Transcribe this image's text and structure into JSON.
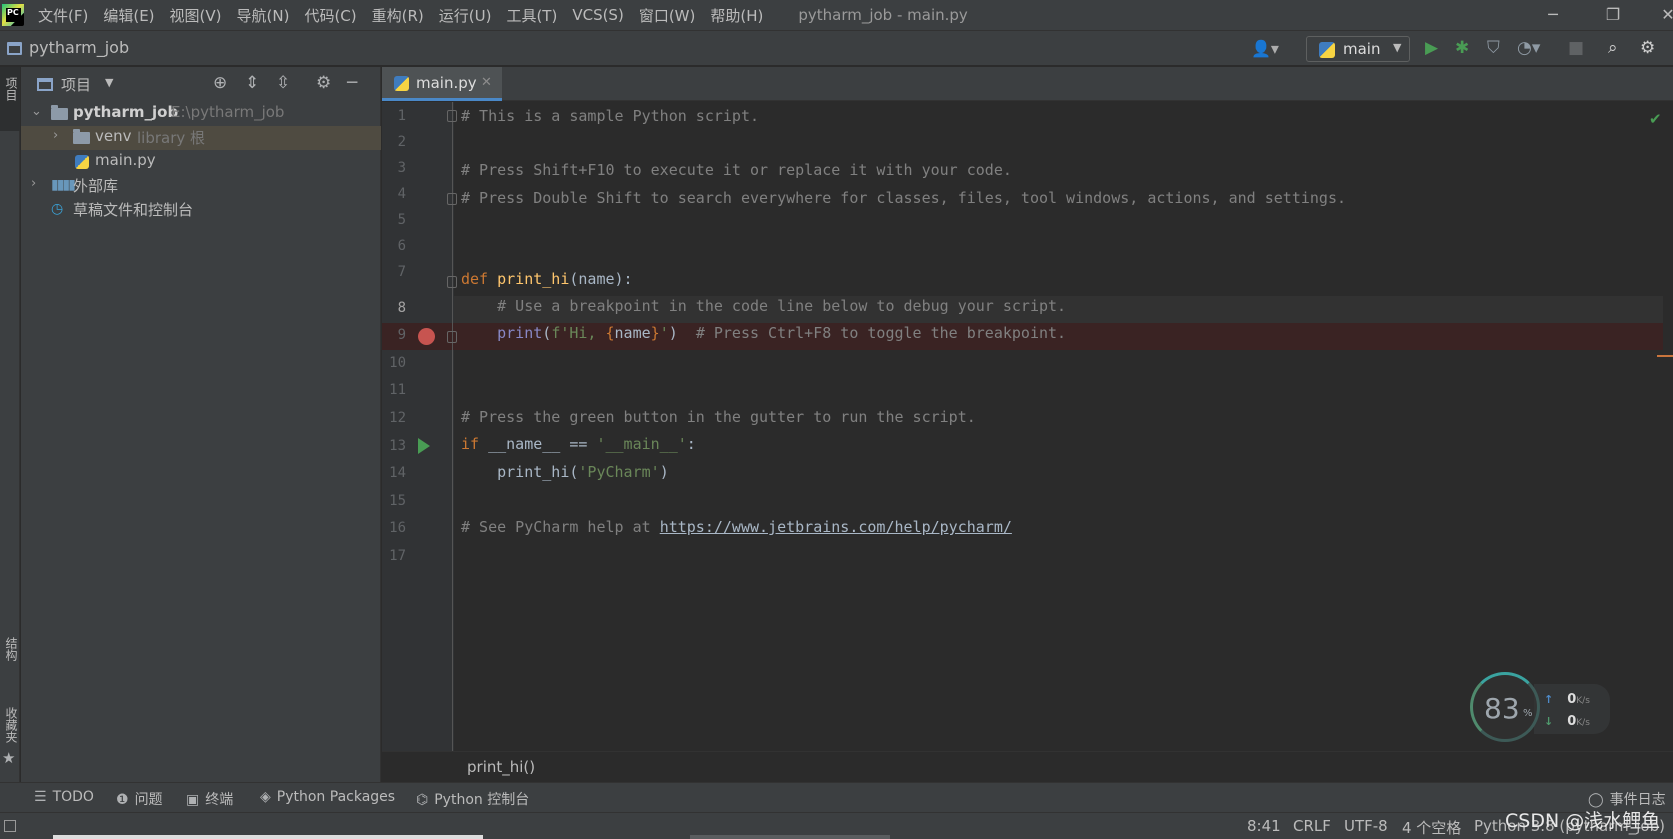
{
  "menubar": {
    "items": [
      "文件(F)",
      "编辑(E)",
      "视图(V)",
      "导航(N)",
      "代码(C)",
      "重构(R)",
      "运行(U)",
      "工具(T)",
      "VCS(S)",
      "窗口(W)",
      "帮助(H)"
    ],
    "window_title": "pytharm_job - main.py"
  },
  "navbar": {
    "project_name": "pytharm_job",
    "run_config": "main"
  },
  "left_strip": {
    "project_label": "项目",
    "structure_label": "结构",
    "favorites_label": "收藏夹"
  },
  "project_panel": {
    "title": "项目",
    "tree": [
      {
        "label": "pytharm_job",
        "hint": "E:\\pytharm_job",
        "expanded": true
      },
      {
        "label": "venv",
        "hint": "library 根",
        "expanded": false,
        "selected": true
      },
      {
        "label": "main.py"
      },
      {
        "label": "外部库",
        "expanded": false
      },
      {
        "label": "草稿文件和控制台"
      }
    ]
  },
  "editor": {
    "tab_label": "main.py",
    "line_numbers": [
      "1",
      "2",
      "3",
      "4",
      "5",
      "6",
      "7",
      "8",
      "9",
      "10",
      "11",
      "12",
      "13",
      "14",
      "15",
      "16",
      "17"
    ],
    "current_line": 8,
    "breakpoint_line": 9,
    "run_line": 13,
    "code": {
      "l1": "# This is a sample Python script.",
      "l3": "# Press Shift+F10 to execute it or replace it with your code.",
      "l4": "# Press Double Shift to search everywhere for classes, files, tool windows, actions, and settings.",
      "l7_kw": "def ",
      "l7_fn": "print_hi",
      "l7_rest": "(name):",
      "l8": "    # Use a breakpoint in the code line below to debug your script.",
      "l9_indent": "    ",
      "l9_builtin": "print",
      "l9_open": "(",
      "l9_str1": "f'Hi, ",
      "l9_brace1": "{",
      "l9_name": "name",
      "l9_brace2": "}",
      "l9_str2": "'",
      "l9_close": ")  ",
      "l9_comment": "# Press Ctrl+F8 to toggle the breakpoint.",
      "l12": "# Press the green button in the gutter to run the script.",
      "l13_kw": "if ",
      "l13_name": "__name__",
      "l13_eq": " == ",
      "l13_str": "'__main__'",
      "l13_colon": ":",
      "l14_indent": "    print_hi(",
      "l14_str": "'PyCharm'",
      "l14_close": ")",
      "l16_comment": "# See PyCharm help at ",
      "l16_link": "https://www.jetbrains.com/help/pycharm/"
    },
    "breadcrumb": "print_hi()"
  },
  "bottom_tools": {
    "todo": "TODO",
    "problems": "问题",
    "terminal": "终端",
    "packages": "Python Packages",
    "console": "Python 控制台",
    "event_log": "事件日志"
  },
  "statusbar": {
    "position": "8:41",
    "line_sep": "CRLF",
    "encoding": "UTF-8",
    "indent": "4 个空格",
    "interpreter": "Python 3.8 (pytharm_job)"
  },
  "net_widget": {
    "cpu": "83",
    "cpu_unit": "%",
    "up": "0",
    "down": "0",
    "unit": "K/s"
  },
  "watermark": "CSDN @浅水鲤鱼",
  "colors": {
    "keyword": "#cc7832",
    "function": "#ffc66d",
    "string": "#6a8759",
    "comment": "#808080",
    "breakpoint": "#c75450",
    "run": "#499c54"
  }
}
